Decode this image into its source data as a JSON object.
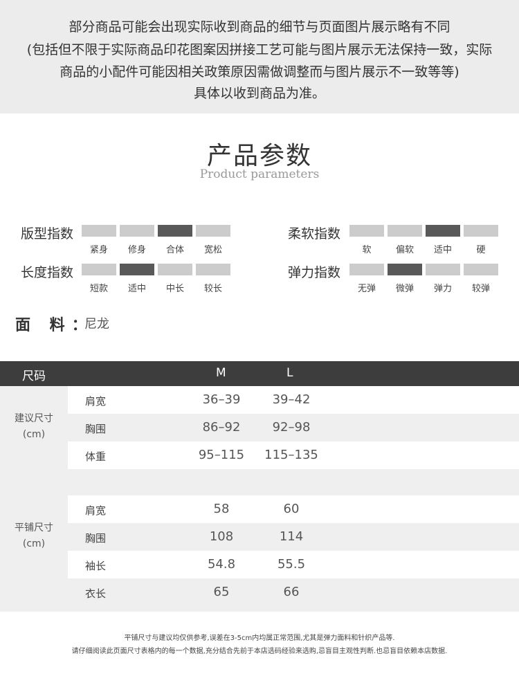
{
  "notice": {
    "lines": [
      "部分商品可能会出现实际收到商品的细节与页面图片展示略有不同",
      "(包括但不限于实际商品印花图案因拼接工艺可能与图片展示无法保持一致，实际",
      "商品的小配件可能因相关政策原因需做调整而与图片展示不一致等等)",
      "具体以收到商品为准。"
    ]
  },
  "header": {
    "title": "产品参数",
    "subtitle": "Product parameters"
  },
  "indices": [
    {
      "label": "版型指数",
      "options": [
        "紧身",
        "修身",
        "合体",
        "宽松"
      ],
      "selected": 2
    },
    {
      "label": "柔软指数",
      "options": [
        "软",
        "偏软",
        "适中",
        "硬"
      ],
      "selected": 2
    },
    {
      "label": "长度指数",
      "options": [
        "短款",
        "适中",
        "中长",
        "较长"
      ],
      "selected": 1
    },
    {
      "label": "弹力指数",
      "options": [
        "无弹",
        "微弹",
        "弹力",
        "较弹"
      ],
      "selected": 1
    }
  ],
  "fabric": {
    "label": "面 料：",
    "value": "尼龙"
  },
  "size_table": {
    "header": {
      "size_label": "尺码",
      "sizes": [
        "M",
        "L"
      ]
    },
    "groups": [
      {
        "name": "建议尺寸",
        "unit": "(cm)",
        "rows": [
          {
            "label": "肩宽",
            "values": [
              "36–39",
              "39–42"
            ]
          },
          {
            "label": "胸围",
            "values": [
              "86–92",
              "92–98"
            ]
          },
          {
            "label": "体重",
            "values": [
              "95–115",
              "115–135"
            ]
          }
        ]
      },
      {
        "name": "平铺尺寸",
        "unit": "(cm)",
        "rows": [
          {
            "label": "肩宽",
            "values": [
              "58",
              "60"
            ]
          },
          {
            "label": "胸围",
            "values": [
              "108",
              "114"
            ]
          },
          {
            "label": "袖长",
            "values": [
              "54.8",
              "55.5"
            ]
          },
          {
            "label": "衣长",
            "values": [
              "65",
              "66"
            ]
          }
        ]
      }
    ]
  },
  "footnotes": [
    "平铺尺寸与建议均仅供参考,误差在3-5cm内均属正常范围,尤其是弹力面料和针织产品等.",
    "请仔细阅读此页面尺寸表格内的每一个数据,充分结合先前于本店选码经验来选购,忌盲目主观性判断.也忌盲目依赖本店数据."
  ],
  "colors": {
    "notice_bg": "#ececec",
    "bar_inactive": "#cccccc",
    "bar_active": "#595959",
    "table_header_bg": "#3d3d3d",
    "row_shade": "#efefef"
  }
}
